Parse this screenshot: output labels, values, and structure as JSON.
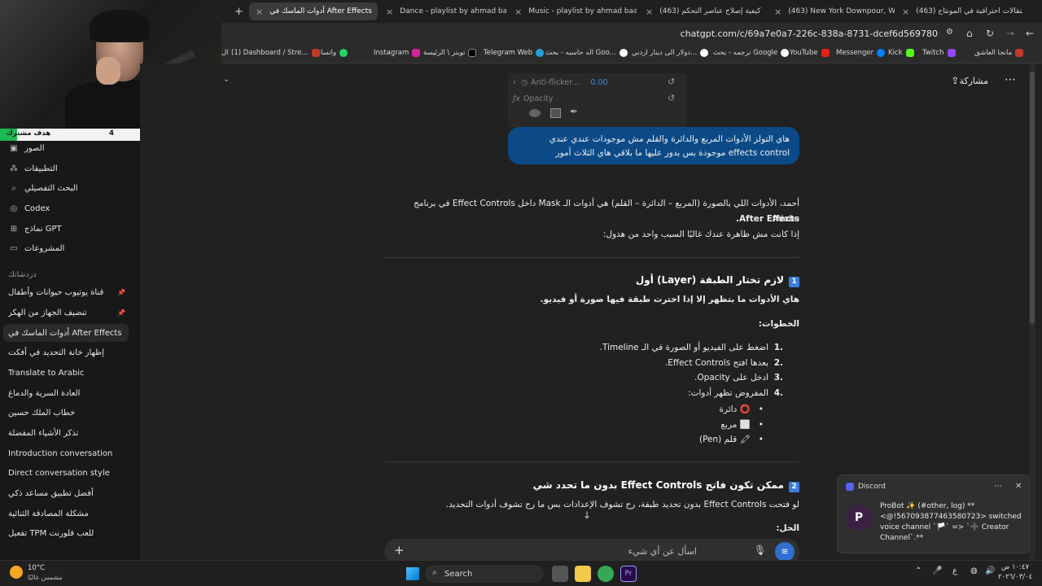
{
  "tabs": [
    {
      "label": "(463) انتقالات احترافية في المونتاج",
      "active": false
    },
    {
      "label": "(463) New York Downpour, Walking",
      "active": false
    },
    {
      "label": "(463) كيفية إصلاح عناصر التحكم",
      "active": false
    },
    {
      "label": "Music - playlist by ahmad baa",
      "active": false
    },
    {
      "label": "Dance - playlist by ahmad baa",
      "active": false
    },
    {
      "label": "أدوات الماسك في After Effects",
      "active": true
    }
  ],
  "new_tab": "+",
  "address": {
    "url": "chatgpt.com/c/69a7e0a7-226c-838a-8731-dcef6d569780"
  },
  "bookmarks": [
    "مانجا العاشق",
    "Twitch",
    "Kick",
    "Messenger",
    "YouTube",
    "ترجمه - بحث Google",
    "دولار الى دينار اردني...",
    "اله حاسبه - بحث Goo...",
    "Telegram Web",
    "تويتر \\ الرئيسة",
    "Instagram",
    "واتساب",
    "(1) Dashboard / Stre...",
    "ال"
  ],
  "stream_goal": {
    "label": "هدف مشترك",
    "current": "4",
    "target": "50",
    "progress": 0.08
  },
  "sidebar": {
    "top_items": [
      {
        "label": "الصور",
        "icon": "image-icon"
      },
      {
        "label": "التطبيقات",
        "icon": "apps-icon"
      },
      {
        "label": "البحث التفصيلي",
        "icon": "research-icon"
      },
      {
        "label": "Codex",
        "icon": "codex-icon"
      },
      {
        "label": "نماذج GPT",
        "icon": "gpt-icon"
      },
      {
        "label": "المشروعات",
        "icon": "folder-icon"
      }
    ],
    "section": "دردشاتك",
    "chats": [
      {
        "label": "قناة يوتيوب حيوانات وأطفال",
        "pinned": true
      },
      {
        "label": "تنضيف الجهاز من الهكر",
        "pinned": true
      },
      {
        "label": "أدوات الماسك في After Effects",
        "active": true
      },
      {
        "label": "إظهار خانة التحديد في أفكت"
      },
      {
        "label": "Translate to Arabic"
      },
      {
        "label": "العادة السرية والدماغ"
      },
      {
        "label": "خطاب الملك حسين"
      },
      {
        "label": "تذكر الأشياء المفضلة"
      },
      {
        "label": "Introduction conversation"
      },
      {
        "label": "Direct conversation style"
      },
      {
        "label": "أفضل تطبيق مساعد ذكي"
      },
      {
        "label": "مشكلة المصادقة الثنائية"
      },
      {
        "label": "تفعيل TPM للعب فلورنت"
      }
    ]
  },
  "header": {
    "share": "مشاركة"
  },
  "ae_panel": {
    "anti_flicker": "Anti-flicker...",
    "anti_value": "0.00",
    "opacity": "Opacity"
  },
  "user_message": "هاي التولز الأدوات المربع والدائرة والقلم مش موجودات عندي عندي effects control موجودة بس بدور عليها ما بلاقي هاي الثلاث أمور",
  "answer": {
    "intro_line1": "أحمد، الأدوات اللي بالصورة (المربع – الدائرة – القلم) هي أدوات الـ Mask داخل Effect Controls في برنامج Adobe",
    "intro_line2": "After Effects.",
    "intro_line3": "إذا كانت مش ظاهرة عندك غالبًا السبب واحد من هذول:",
    "s1_num": "1",
    "s1_title": "لازم تختار الطبقة (Layer) أول",
    "s1_text": "هاي الأدوات ما بتظهر إلا إذا اخترت طبقة فيها صورة أو فيديو.",
    "steps_title": "الخطوات:",
    "steps": [
      "اضغط على الفيديو أو الصورة في الـ Timeline.",
      "بعدها افتح Effect Controls.",
      "ادخل على Opacity.",
      "المفروض تظهر أدوات:"
    ],
    "bullets": [
      {
        "text": "دائرة",
        "emoji": "⭕"
      },
      {
        "text": "مربع",
        "emoji": "⬜"
      },
      {
        "text": "قلم (Pen)",
        "emoji": "🖍"
      }
    ],
    "s2_num": "2",
    "s2_title": "ممكن تكون فاتح Effect Controls بدون ما تحدد شي",
    "s2_text": "لو فتحت Effect Controls بدون تحديد طبقة، رح تشوف الإعدادات بس ما رح تشوف أدوات التحديد.",
    "solution": "الحل:"
  },
  "composer": {
    "placeholder": "اسأل عن أي شيء"
  },
  "discord": {
    "app": "Discord",
    "avatar": "P",
    "message": "ProBot ✨ (#other, log) **<@!567093877463580723> switched voice channel `🏳️` => `➕ Creator Channel`.**"
  },
  "taskbar": {
    "weather_temp": "10°C",
    "weather_desc": "مشمس غالبًا",
    "search": "Search",
    "lang": "ع",
    "time": "١٠:٤٧ ص",
    "date": "٢٠٢٦/٠٣/٠٤"
  }
}
